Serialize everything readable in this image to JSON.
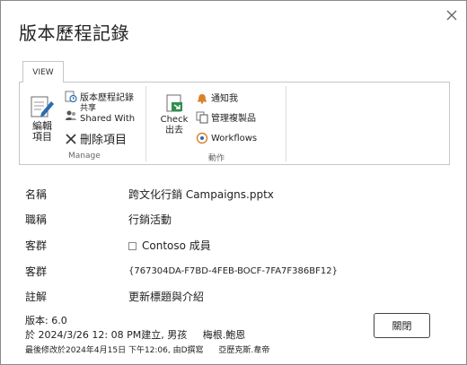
{
  "dialog": {
    "title": "版本歷程記錄",
    "close_icon": "close-icon"
  },
  "ribbon": {
    "tab": "VIEW",
    "groups": {
      "manage": {
        "label": "Manage",
        "edit_label": "編輯\n項目",
        "version_history": "版本歷程記錄",
        "shared_with_cn": "共享",
        "shared_with_en": "Shared With",
        "delete_item": "刪除項目"
      },
      "actions": {
        "label": "動作",
        "check_out_en": "Check",
        "check_out_cn": "出去",
        "alert_me": "通知我",
        "manage_copies": "管理複製品",
        "workflows": "Workflows"
      }
    }
  },
  "fields": [
    {
      "label": "名稱",
      "value": "跨文化行銷 Campaigns.pptx"
    },
    {
      "label": "職稱",
      "value": "行銷活動"
    },
    {
      "label": "客群",
      "value": "Contoso 成員"
    },
    {
      "label": "客群",
      "value": "{767304DA-F7BD-4FEB-BOCF-7FA7F386BF12}"
    },
    {
      "label": "註解",
      "value": "更新標題與介紹"
    }
  ],
  "meta": {
    "version": "版本: 6.0",
    "created": "於 2024/3/26 12: 08 PM建立, 男孩",
    "created_by": "梅根.鮑恩",
    "modified": "最後修改於2024年4月15日 下午12:06, 由D撰寫",
    "modified_by": "亞歷克斯.韋帝"
  },
  "footer": {
    "close_label": "關閉"
  },
  "colors": {
    "accent_blue": "#2b6cb0",
    "icon_orange": "#d9822b",
    "icon_green": "#2f8f4e",
    "border": "#8a8a8a"
  }
}
